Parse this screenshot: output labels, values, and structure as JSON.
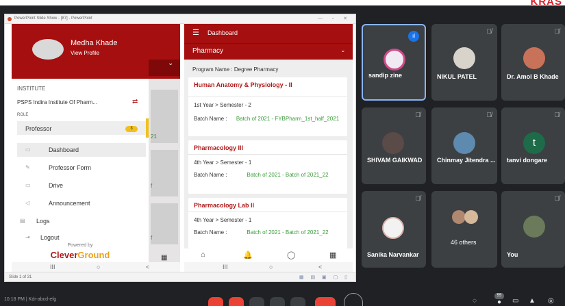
{
  "corner_brand": "KRAS",
  "shared_window": {
    "title": "PowerPoint Slide Show - [87] - PowerPoint",
    "controls": "— ▫ ✕",
    "status_left": "Slide 1 of 31",
    "status_right": "▦ ▤ ▣ ▢ ▯"
  },
  "drawer": {
    "user_name": "Medha Khade",
    "view_profile": "View Profile",
    "institute_label": "INSTITUTE",
    "institute_value": "PSPS Indira Institute Of Pharm...",
    "role_label": "ROLE",
    "role_value": "Professor",
    "role_badge": "3",
    "menu": [
      {
        "label": "Dashboard",
        "icon": "dashboard-icon"
      },
      {
        "label": "Professor Form",
        "icon": "form-icon"
      },
      {
        "label": "Drive",
        "icon": "drive-icon"
      },
      {
        "label": "Announcement",
        "icon": "megaphone-icon"
      },
      {
        "label": "Logs",
        "icon": "logs-icon"
      },
      {
        "label": "Logout",
        "icon": "logout-icon"
      }
    ],
    "powered_by": "Powered by",
    "logo_clever": "Clever",
    "logo_ground": "Ground",
    "ghost_texts": [
      "21",
      "f",
      "f"
    ]
  },
  "app": {
    "header_title": "Dashboard",
    "selector_value": "Pharmacy",
    "program_name": "Program Name : Degree Pharmacy",
    "batch_label": "Batch Name :",
    "courses": [
      {
        "title": "Human Anatomy & Physiology - II",
        "year": "1st Year > Semester - 2",
        "batch": "Batch of 2021 - FYBPharm_1st_half_2021"
      },
      {
        "title": "Pharmacology III",
        "year": "4th Year > Semester - 1",
        "batch": "Batch of 2021 - Batch of 2021_22"
      },
      {
        "title": "Pharmacology Lab II",
        "year": "4th Year > Semester - 1",
        "batch": "Batch of 2021 - Batch of 2021_22"
      }
    ]
  },
  "android_nav": {
    "recent": "III",
    "home": "○",
    "back": "<"
  },
  "participants": [
    {
      "name": "sandip zine",
      "status": "speaking"
    },
    {
      "name": "NIKUL PATEL",
      "status": "muted"
    },
    {
      "name": "Dr. Amol B Khade",
      "status": "muted"
    },
    {
      "name": "SHIVAM GAIKWAD",
      "status": "muted"
    },
    {
      "name": "Chinmay Jitendra ...",
      "status": "muted"
    },
    {
      "name": "tanvi dongare",
      "status": "muted",
      "avatar_letter": "t"
    },
    {
      "name": "Sanika Narvankar",
      "status": "muted"
    },
    {
      "name": "46 others",
      "status": "group"
    },
    {
      "name": "You",
      "status": "muted"
    }
  ],
  "meet_toolbar": {
    "meeting_info": "10:18 PM  |  Kdr-abcd-efg",
    "participant_count": "55"
  },
  "colors": {
    "brand_red": "#a50f0f",
    "accent_yellow": "#f0c020",
    "batch_green": "#3a9a3a",
    "meet_bg": "#202124",
    "tile_bg": "#3c4043",
    "active_border": "#8ab4f8"
  }
}
